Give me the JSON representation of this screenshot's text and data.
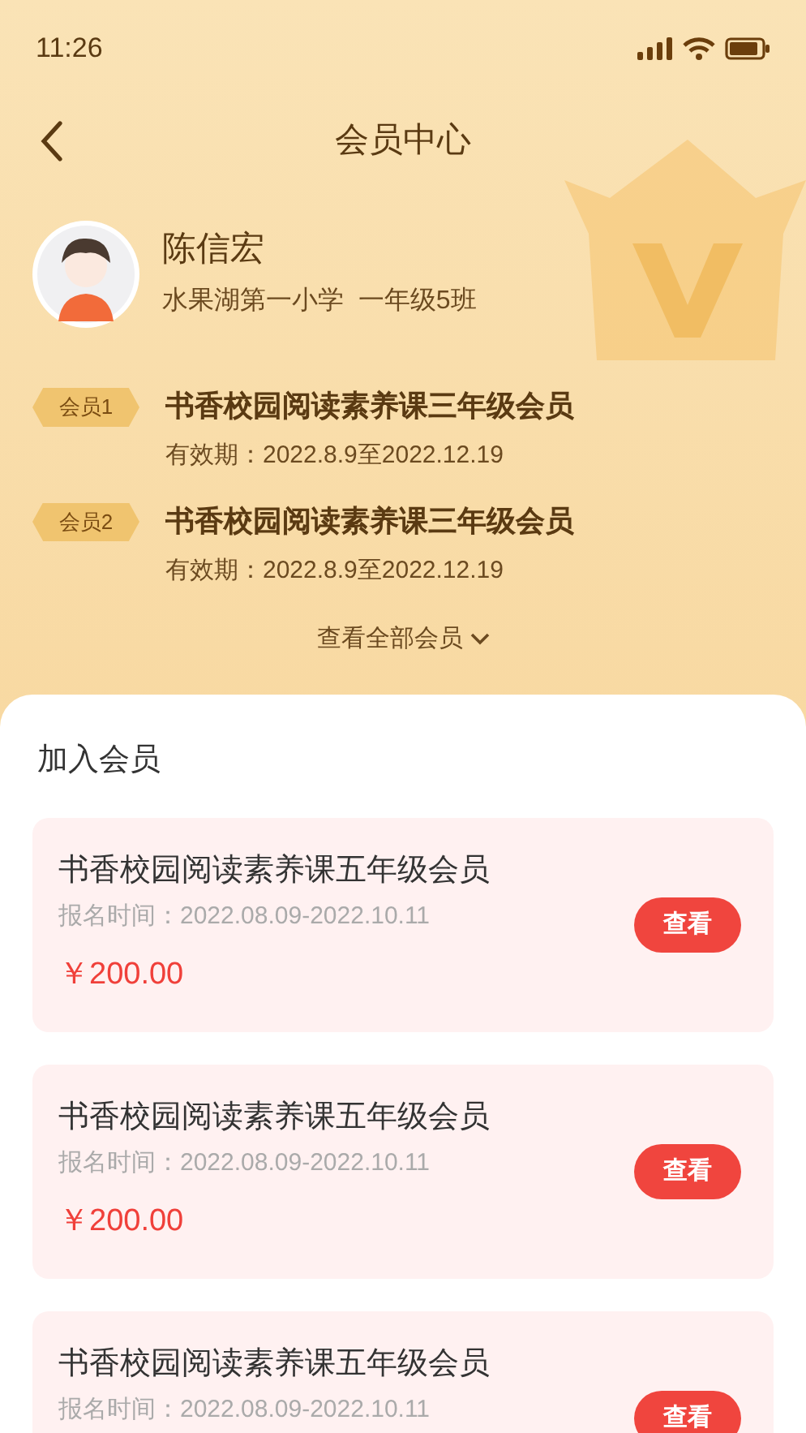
{
  "status_bar": {
    "time": "11:26"
  },
  "nav": {
    "title": "会员中心"
  },
  "user": {
    "name": "陈信宏",
    "school": "水果湖第一小学  一年级5班"
  },
  "memberships": [
    {
      "tag": "会员1",
      "title": "书香校园阅读素养课三年级会员",
      "validity": "有效期：2022.8.9至2022.12.19"
    },
    {
      "tag": "会员2",
      "title": "书香校园阅读素养课三年级会员",
      "validity": "有效期：2022.8.9至2022.12.19"
    }
  ],
  "view_all": "查看全部会员",
  "join_section": {
    "title": "加入会员",
    "plans": [
      {
        "title": "书香校园阅读素养课五年级会员",
        "period": "报名时间：2022.08.09-2022.10.11",
        "price": "￥200.00",
        "button": "查看"
      },
      {
        "title": "书香校园阅读素养课五年级会员",
        "period": "报名时间：2022.08.09-2022.10.11",
        "price": "￥200.00",
        "button": "查看"
      },
      {
        "title": "书香校园阅读素养课五年级会员",
        "period": "报名时间：2022.08.09-2022.10.11",
        "button": "查看"
      }
    ]
  }
}
